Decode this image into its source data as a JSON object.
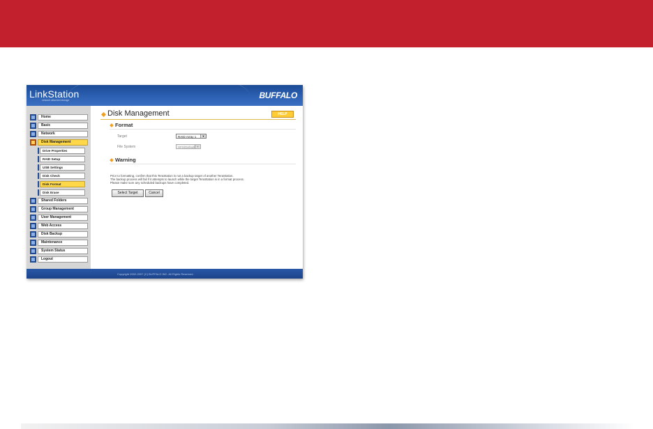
{
  "app": {
    "product_name": "LinkStation",
    "tagline": "network attached storage",
    "brand": "BUFFALO",
    "footer": "Copyright 2002-2007 (C) BUFFALO INC. All Rights Reserved."
  },
  "sidebar": {
    "items": [
      {
        "label": "Home",
        "icon": "home-icon"
      },
      {
        "label": "Basic",
        "icon": "basic-icon"
      },
      {
        "label": "Network",
        "icon": "network-icon"
      },
      {
        "label": "Disk Management",
        "icon": "disk-icon",
        "active": true
      },
      {
        "label": "Shared Folders",
        "icon": "folder-icon"
      },
      {
        "label": "Group Management",
        "icon": "group-icon"
      },
      {
        "label": "User Management",
        "icon": "user-icon"
      },
      {
        "label": "Web Access",
        "icon": "web-icon"
      },
      {
        "label": "Disk Backup",
        "icon": "backup-icon"
      },
      {
        "label": "Maintenance",
        "icon": "maintenance-icon"
      },
      {
        "label": "System Status",
        "icon": "status-icon"
      },
      {
        "label": "Logout",
        "icon": "logout-icon"
      }
    ],
    "subitems": [
      {
        "label": "Drive Properties"
      },
      {
        "label": "RAID Setup"
      },
      {
        "label": "USB Settings"
      },
      {
        "label": "Disk Check"
      },
      {
        "label": "Disk Format",
        "active": true
      },
      {
        "label": "Disk Erase"
      }
    ]
  },
  "main": {
    "title": "Disk Management",
    "help": "HELP",
    "format": {
      "title": "Format",
      "target_label": "Target",
      "target_value": "RAID Array 1",
      "fs_label": "File System",
      "fs_value": "XFS(Default)"
    },
    "warning": {
      "title": "Warning",
      "lines": [
        "Prior to formatting, confirm that this TeraStation is not a backup target of another TeraStation.",
        "The backup process will fail if it attempts to launch while the target TeraStation is in a format process.",
        "Please make sure any scheduled backups have completed."
      ]
    },
    "buttons": {
      "select_target": "Select Target",
      "cancel": "Cancel"
    }
  },
  "colors": {
    "banner": "#c1202c",
    "accent": "#ffd84a",
    "header_blue": "#2d62b5"
  }
}
